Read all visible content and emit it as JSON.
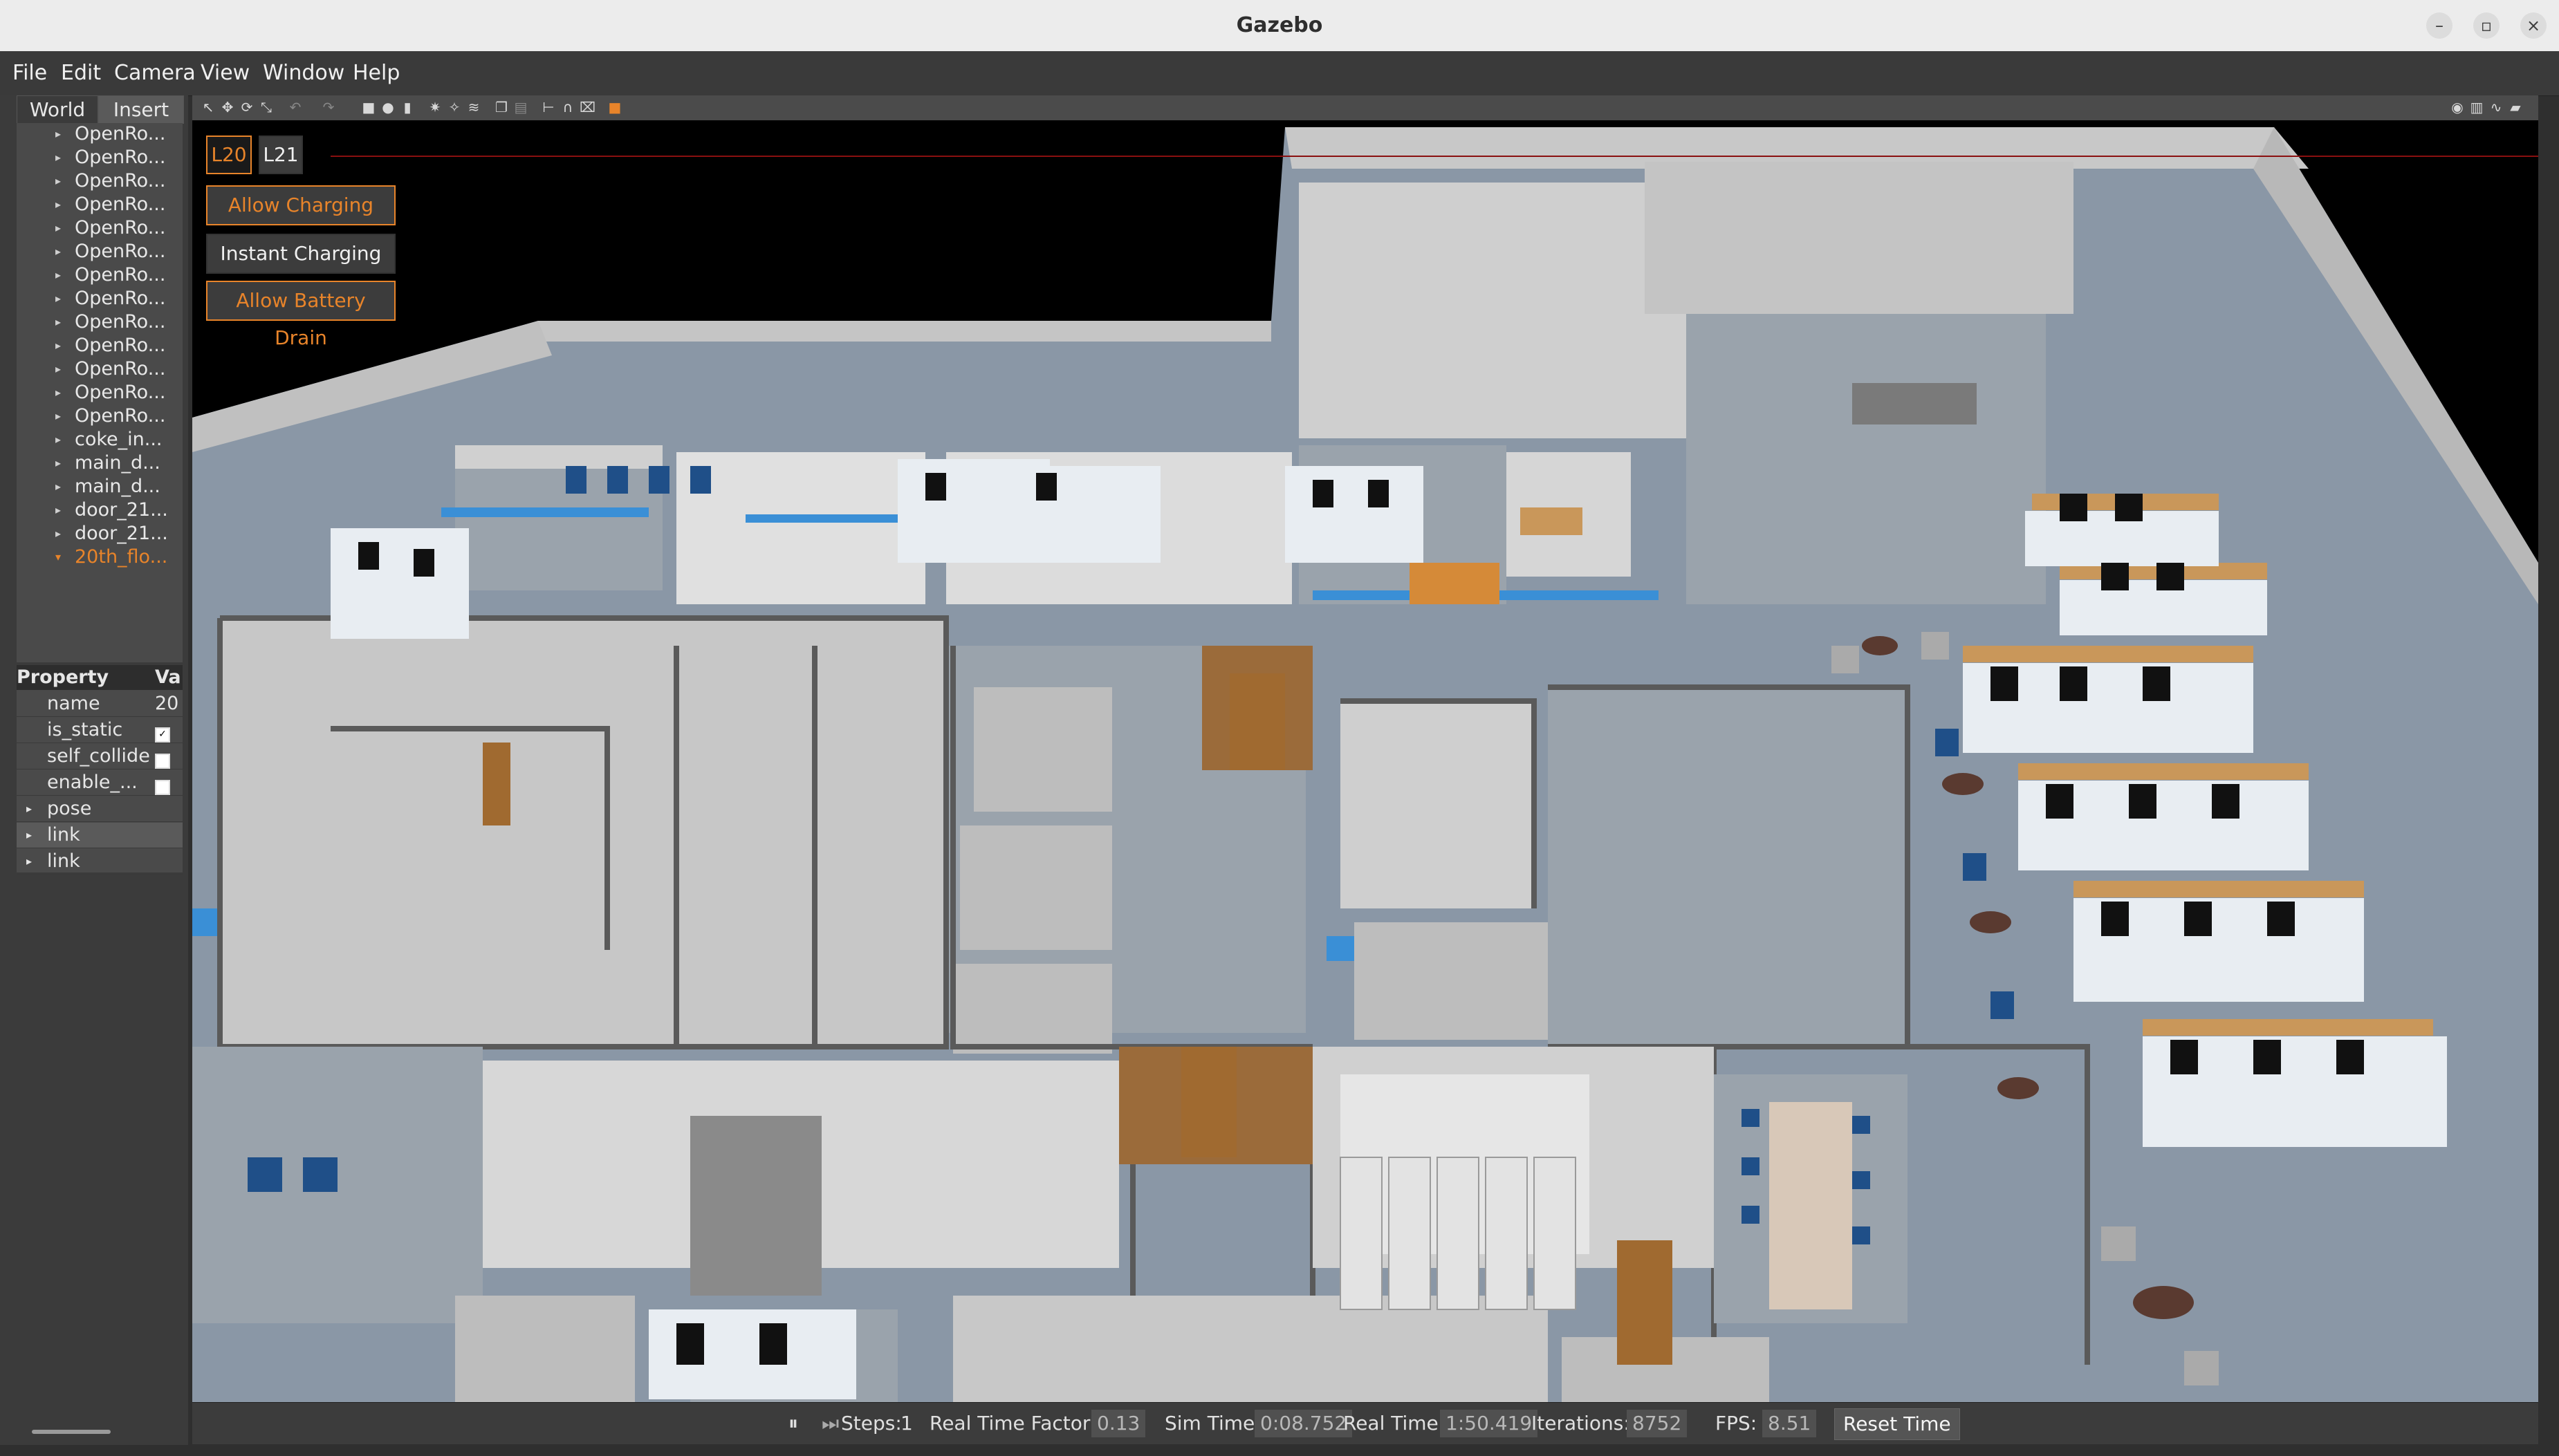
{
  "window": {
    "title": "Gazebo"
  },
  "menu": [
    "File",
    "Edit",
    "Camera",
    "View",
    "Window",
    "Help"
  ],
  "left_panel": {
    "tabs": [
      "World",
      "Insert"
    ],
    "tree_items": [
      "OpenRo...",
      "OpenRo...",
      "OpenRo...",
      "OpenRo...",
      "OpenRo...",
      "OpenRo...",
      "OpenRo...",
      "OpenRo...",
      "OpenRo...",
      "OpenRo...",
      "OpenRo...",
      "OpenRo...",
      "OpenRo...",
      "coke_in...",
      "main_d...",
      "main_d...",
      "door_21...",
      "door_21...",
      "20th_flo..."
    ],
    "property_header": "Property",
    "value_header": "Va",
    "properties": [
      {
        "name": "name",
        "value": "20"
      },
      {
        "name": "is_static",
        "value": "checked"
      },
      {
        "name": "self_collide",
        "value": "F"
      },
      {
        "name": "enable_...",
        "value": "F"
      }
    ],
    "expandables": [
      "pose",
      "link",
      "link"
    ]
  },
  "overlay": {
    "levels": [
      "L20",
      "L21"
    ],
    "buttons": [
      "Allow Charging",
      "Instant Charging",
      "Allow Battery Drain"
    ],
    "accent_color": "#e8842a"
  },
  "status_bar": {
    "steps_label": "Steps:",
    "steps_value": "1",
    "rtf_label": "Real Time Factor:",
    "rtf_value": "0.13",
    "sim_time_label": "Sim Time:",
    "sim_time_value": "0:08.752",
    "real_time_label": "Real Time:",
    "real_time_value": "1:50.419",
    "iterations_label": "Iterations:",
    "iterations_value": "8752",
    "fps_label": "FPS:",
    "fps_value": "8.51",
    "reset_label": "Reset Time"
  }
}
